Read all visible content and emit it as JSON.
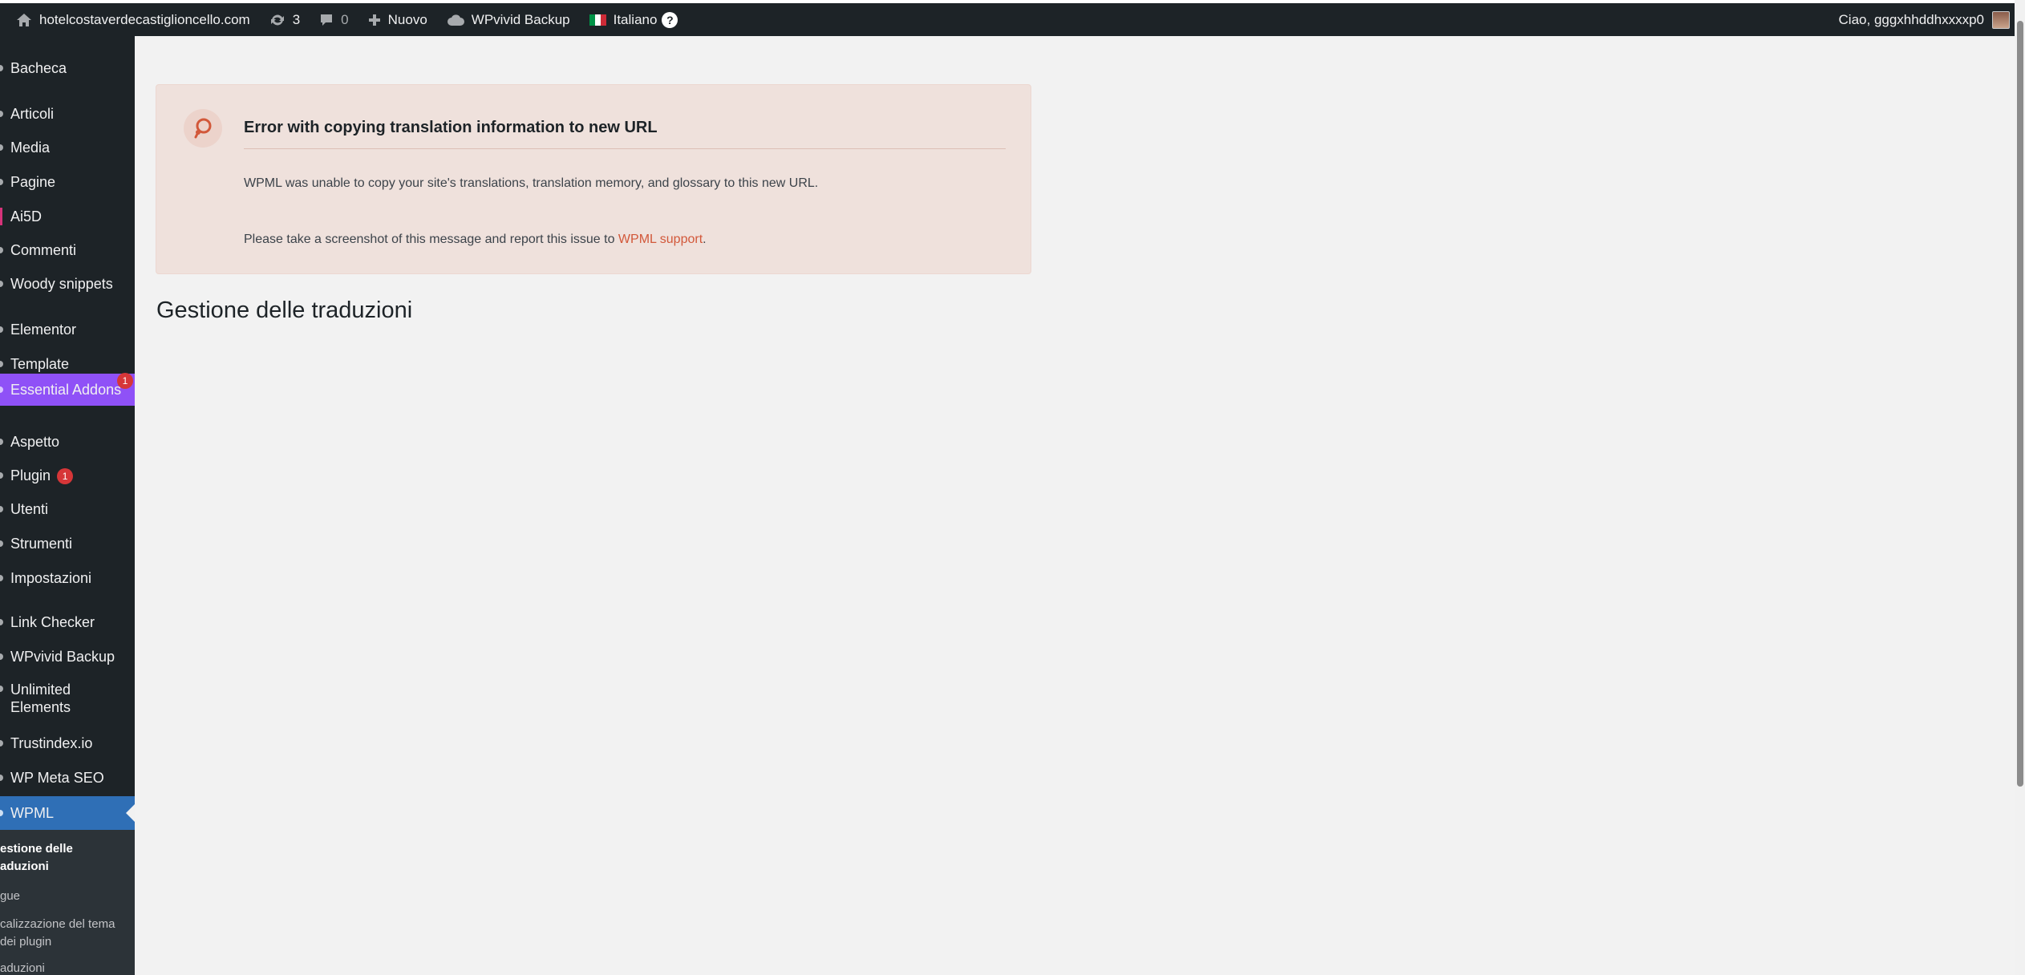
{
  "admin_bar": {
    "site_name": "hotelcostaverdecastiglioncello.com",
    "updates_count": "3",
    "comments_count": "0",
    "new_label": "Nuovo",
    "backup_label": "WPvivid Backup",
    "language_label": "Italiano",
    "help_label": "?",
    "greeting": "Ciao, gggxhhddhxxxxp0"
  },
  "sidebar": {
    "items": [
      {
        "label": "Bacheca"
      },
      {
        "label": "Articoli"
      },
      {
        "label": "Media"
      },
      {
        "label": "Pagine"
      },
      {
        "label": "Ai5D"
      },
      {
        "label": "Commenti"
      },
      {
        "label": "Woody snippets"
      },
      {
        "label": "Elementor"
      },
      {
        "label": "Template"
      },
      {
        "label": "Essential Addons",
        "badge": "1"
      },
      {
        "label": "Aspetto"
      },
      {
        "label": "Plugin",
        "badge": "1"
      },
      {
        "label": "Utenti"
      },
      {
        "label": "Strumenti"
      },
      {
        "label": "Impostazioni"
      },
      {
        "label": "Link Checker"
      },
      {
        "label": "WPvivid Backup"
      },
      {
        "label": "Unlimited Elements"
      },
      {
        "label": "Trustindex.io"
      },
      {
        "label": "WP Meta SEO"
      },
      {
        "label": "WPML"
      }
    ],
    "submenu": [
      {
        "label": "estione delle"
      },
      {
        "label": "aduzioni"
      },
      {
        "label": "gue"
      },
      {
        "label": "calizzazione del tema"
      },
      {
        "label": "dei plugin"
      },
      {
        "label": "aduzioni"
      }
    ]
  },
  "notice": {
    "title": "Error with copying translation information to new URL",
    "line1": "WPML was unable to copy your site's translations, translation memory, and glossary to this new URL.",
    "line2_prefix": "Please take a screenshot of this message and report this issue to ",
    "link": "WPML support",
    "line2_suffix": "."
  },
  "page": {
    "title": "Gestione delle traduzioni"
  },
  "colors": {
    "admin_bar_bg": "#1d2327",
    "essential_addons_bg": "#8f51f7",
    "wpml_active_bg": "#2f6fb6",
    "notice_bg": "#efe1dc",
    "link_color": "#d2583a",
    "badge_red": "#d63638"
  }
}
